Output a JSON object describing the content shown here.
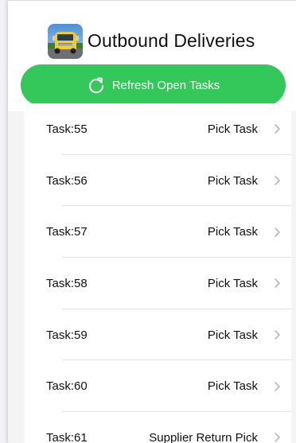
{
  "header": {
    "title": "Outbound Deliveries",
    "logo_icon": "truck-logo-icon"
  },
  "refresh_button": {
    "label": "Refresh Open Tasks",
    "icon": "refresh-icon",
    "color": "#34c759"
  },
  "tasks": [
    {
      "task": "Task:55",
      "type": "Pick Task"
    },
    {
      "task": "Task:56",
      "type": "Pick Task"
    },
    {
      "task": "Task:57",
      "type": "Pick Task"
    },
    {
      "task": "Task:58",
      "type": "Pick Task"
    },
    {
      "task": "Task:59",
      "type": "Pick Task"
    },
    {
      "task": "Task:60",
      "type": "Pick Task"
    },
    {
      "task": "Task:61",
      "type": "Supplier Return Pick"
    }
  ]
}
